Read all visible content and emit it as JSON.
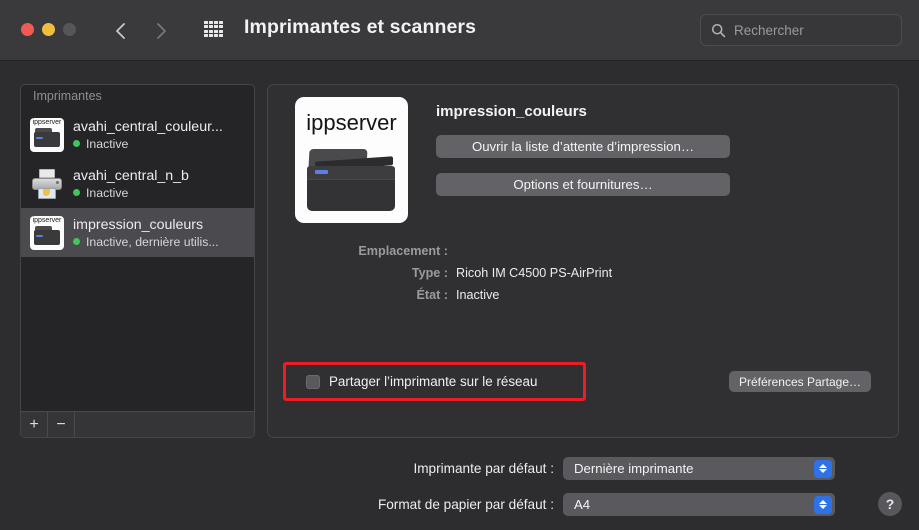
{
  "window": {
    "title": "Imprimantes et scanners",
    "traffic_lights": [
      "close",
      "minimize",
      "zoom"
    ],
    "nav": {
      "back": "back-chevron",
      "forward": "forward-chevron",
      "grid": "show-all-grid"
    }
  },
  "search": {
    "placeholder": "Rechercher",
    "value": "",
    "icon": "search-icon"
  },
  "sidebar": {
    "header": "Imprimantes",
    "printers": [
      {
        "name": "avahi_central_couleur...",
        "status": "Inactive",
        "status_color": "#3fc65c",
        "icon": "ipp-printer-icon",
        "icon_label": "ippserver",
        "selected": false
      },
      {
        "name": "avahi_central_n_b",
        "status": "Inactive",
        "status_color": "#3fc65c",
        "icon": "classic-printer-icon",
        "icon_label": "",
        "selected": false
      },
      {
        "name": "impression_couleurs",
        "status": "Inactive, dernière utilis...",
        "status_color": "#3fc65c",
        "icon": "ipp-printer-icon",
        "icon_label": "ippserver",
        "selected": true
      }
    ],
    "add_label": "+",
    "remove_label": "−"
  },
  "detail": {
    "icon_label": "ippserver",
    "printer_name": "impression_couleurs",
    "open_queue_button": "Ouvrir la liste d’attente d’impression…",
    "options_button": "Options et fournitures…",
    "fields": [
      {
        "label": "Emplacement :",
        "value": ""
      },
      {
        "label": "Type :",
        "value": "Ricoh IM C4500 PS-AirPrint"
      },
      {
        "label": "État :",
        "value": "Inactive"
      }
    ],
    "share_checkbox": {
      "label": "Partager l’imprimante sur le réseau",
      "checked": false,
      "highlight_color": "#ee1c25"
    },
    "share_prefs_button": "Préférences Partage…"
  },
  "footer": {
    "default_printer": {
      "label": "Imprimante par défaut :",
      "value": "Dernière imprimante"
    },
    "default_paper": {
      "label": "Format de papier par défaut :",
      "value": "A4"
    },
    "help_label": "?"
  }
}
